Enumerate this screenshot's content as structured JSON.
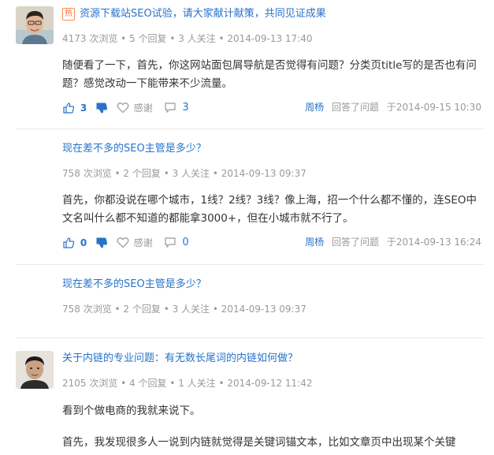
{
  "items": [
    {
      "badge": "热",
      "title": "资源下载站SEO试验，请大家献计献策，共同见证成果",
      "meta": "4173 次浏览 • 5 个回复 • 3 人关注 • 2014-09-13 17:40",
      "content": "随便看了一下，首先，你这网站面包屑导航是否觉得有问题？分类页title写的是否也有问题？感觉改动一下能带来不少流量。",
      "votes": "3",
      "thanks": "感谢",
      "comments": "3",
      "author": "周杨",
      "answered": "回答了问题",
      "time": "于2014-09-15 10:30"
    },
    {
      "title": "现在差不多的SEO主管是多少？",
      "meta": "758 次浏览 • 2 个回复 • 3 人关注 • 2014-09-13 09:37",
      "content": "首先，你都没说在哪个城市，1线？2线？3线？像上海，招一个什么都不懂的，连SEO中文名叫什么都不知道的都能拿3000+，但在小城市就不行了。",
      "votes": "0",
      "thanks": "感谢",
      "comments": "0",
      "author": "周杨",
      "answered": "回答了问题",
      "time": "于2014-09-13 16:24"
    },
    {
      "title": "现在差不多的SEO主管是多少？",
      "meta": "758 次浏览 • 2 个回复 • 3 人关注 • 2014-09-13 09:37"
    },
    {
      "title": "关于内链的专业问题：有无数长尾词的内链如何做？",
      "meta": "2105 次浏览 • 4 个回复 • 1 人关注 • 2014-09-12 11:42",
      "content_p1": "看到个做电商的我就来说下。",
      "content_p2": "首先，我发现很多人一说到内链就觉得是关键词锚文本，比如文章页中出现某个关键"
    }
  ]
}
